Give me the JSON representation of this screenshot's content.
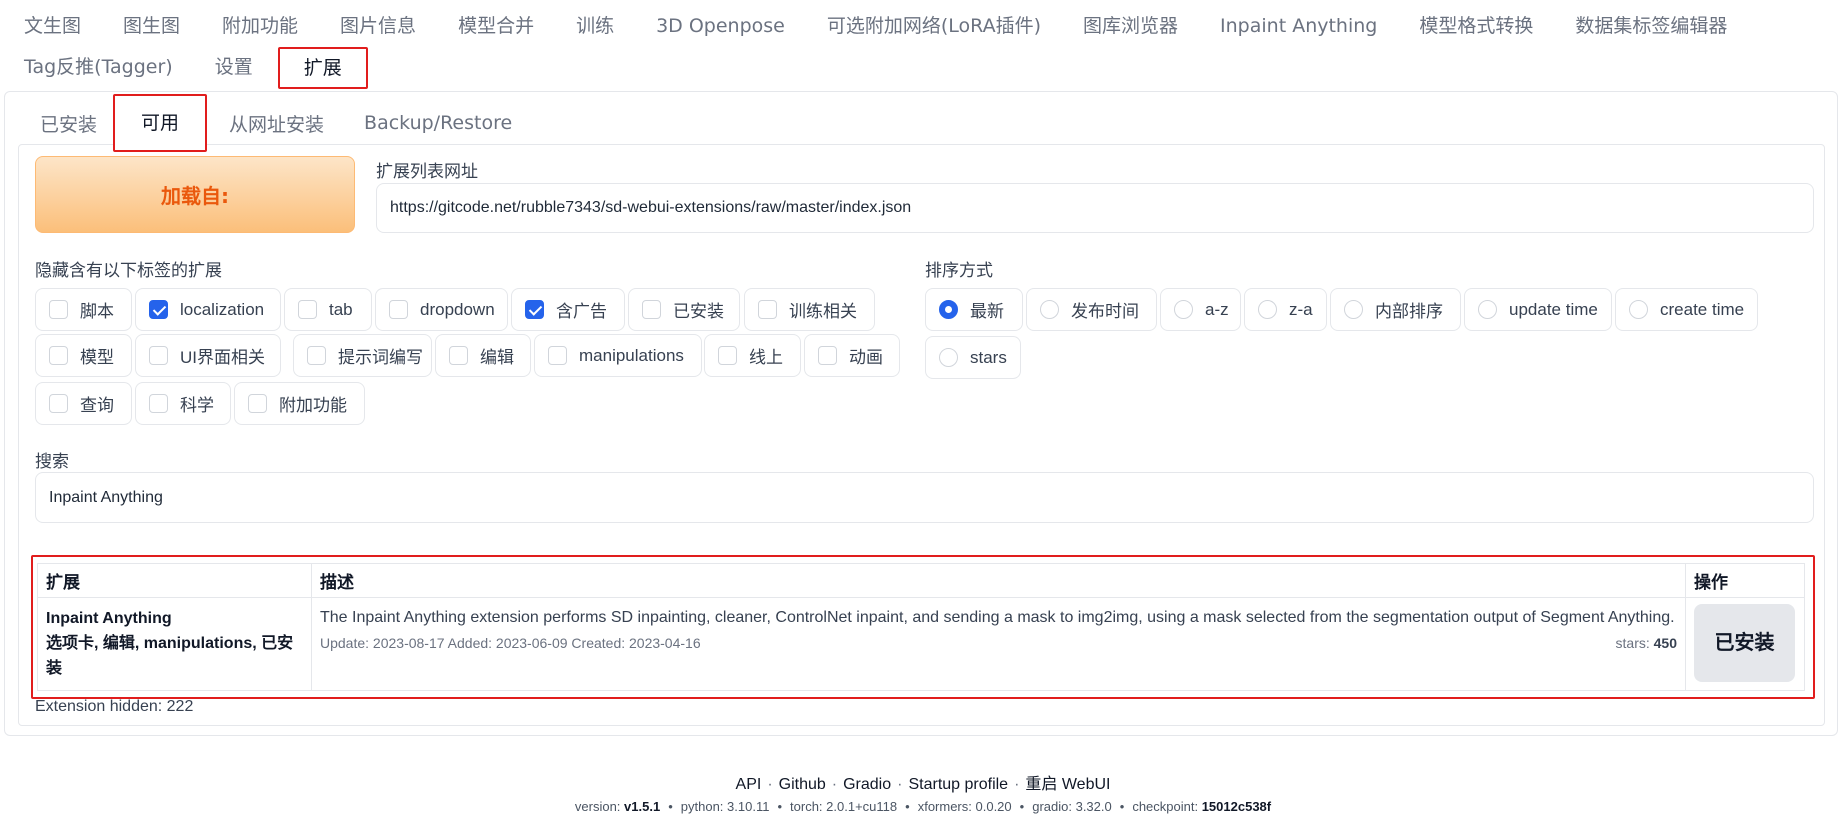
{
  "top_tabs_row1": [
    "文生图",
    "图生图",
    "附加功能",
    "图片信息",
    "模型合并",
    "训练",
    "3D Openpose",
    "可选附加网络(LoRA插件)",
    "图库浏览器",
    "Inpaint Anything",
    "模型格式转换",
    "数据集标签编辑器"
  ],
  "top_tabs_row2": [
    "Tag反推(Tagger)",
    "设置",
    "扩展"
  ],
  "active_top_tab": "扩展",
  "sub_tabs": [
    "已安装",
    "可用",
    "从网址安装",
    "Backup/Restore"
  ],
  "active_sub_tab": "可用",
  "load_button": "加载自:",
  "extension_list_url": {
    "label": "扩展列表网址",
    "value": "https://gitcode.net/rubble7343/sd-webui-extensions/raw/master/index.json"
  },
  "hide_tags": {
    "label": "隐藏含有以下标签的扩展",
    "options": [
      {
        "label": "脚本",
        "checked": false
      },
      {
        "label": "localization",
        "checked": true
      },
      {
        "label": "tab",
        "checked": false
      },
      {
        "label": "dropdown",
        "checked": false
      },
      {
        "label": "含广告",
        "checked": true
      },
      {
        "label": "已安装",
        "checked": false
      },
      {
        "label": "训练相关",
        "checked": false
      },
      {
        "label": "模型",
        "checked": false
      },
      {
        "label": "UI界面相关",
        "checked": false
      },
      {
        "label": "提示词编写",
        "checked": false
      },
      {
        "label": "编辑",
        "checked": false
      },
      {
        "label": "manipulations",
        "checked": false
      },
      {
        "label": "线上",
        "checked": false
      },
      {
        "label": "动画",
        "checked": false
      },
      {
        "label": "查询",
        "checked": false
      },
      {
        "label": "科学",
        "checked": false
      },
      {
        "label": "附加功能",
        "checked": false
      }
    ]
  },
  "sort": {
    "label": "排序方式",
    "options": [
      "最新",
      "发布时间",
      "a-z",
      "z-a",
      "内部排序",
      "update time",
      "create time",
      "stars"
    ],
    "selected": "最新"
  },
  "search": {
    "label": "搜索",
    "value": "Inpaint Anything"
  },
  "table": {
    "headers": [
      "扩展",
      "描述",
      "操作"
    ],
    "rows": [
      {
        "name": "Inpaint Anything",
        "tags": "选项卡, 编辑, manipulations, 已安装",
        "description": "The Inpaint Anything extension performs SD inpainting, cleaner, ControlNet inpaint, and sending a mask to img2img, using a mask selected from the segmentation output of Segment Anything.",
        "dates": "Update: 2023-08-17 Added: 2023-06-09 Created: 2023-04-16",
        "stars_label": "stars:",
        "stars": "450",
        "action": "已安装"
      }
    ]
  },
  "extension_hidden": "Extension hidden: 222",
  "footer": {
    "links": [
      "API",
      "Github",
      "Gradio",
      "Startup profile",
      "重启 WebUI"
    ],
    "info": [
      {
        "key": "version:",
        "value": "v1.5.1"
      },
      {
        "key": "python:",
        "value": "3.10.11"
      },
      {
        "key": "torch:",
        "value": "2.0.1+cu118"
      },
      {
        "key": "xformers:",
        "value": "0.0.20"
      },
      {
        "key": "gradio:",
        "value": "3.32.0"
      },
      {
        "key": "checkpoint:",
        "value": "15012c538f"
      }
    ]
  },
  "colors": {
    "highlight_border": "#e11d1d",
    "accent_blue": "#2563eb",
    "load_button_text": "#ea580c"
  }
}
